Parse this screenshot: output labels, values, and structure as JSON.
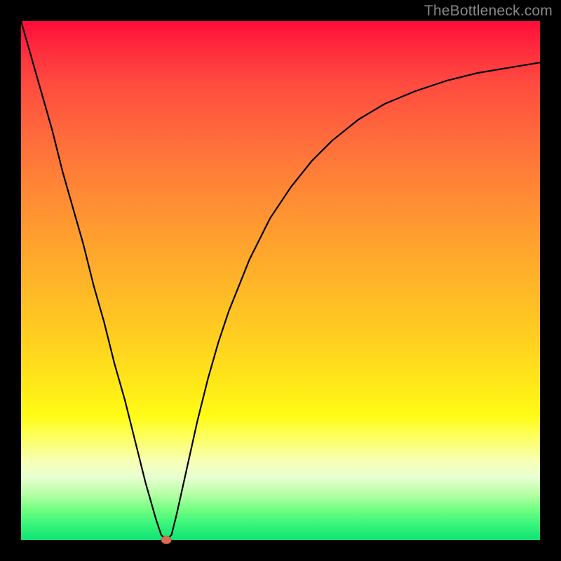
{
  "watermark": "TheBottleneck.com",
  "chart_data": {
    "type": "line",
    "title": "",
    "xlabel": "",
    "ylabel": "",
    "xlim": [
      0,
      100
    ],
    "ylim": [
      0,
      100
    ],
    "grid": false,
    "legend": false,
    "background_gradient": {
      "direction": "vertical",
      "stops": [
        {
          "pos": 0.0,
          "color": "#ff0d3a"
        },
        {
          "pos": 0.2,
          "color": "#ff6a3c"
        },
        {
          "pos": 0.45,
          "color": "#ffb927"
        },
        {
          "pos": 0.7,
          "color": "#ffe819"
        },
        {
          "pos": 0.88,
          "color": "#e7ffd0"
        },
        {
          "pos": 1.0,
          "color": "#10e274"
        }
      ]
    },
    "series": [
      {
        "name": "bottleneck-curve",
        "x": [
          0,
          2,
          4,
          6,
          8,
          10,
          12,
          14,
          16,
          18,
          20,
          22,
          24,
          26,
          27,
          28,
          29,
          30,
          32,
          34,
          36,
          38,
          40,
          44,
          48,
          52,
          56,
          60,
          65,
          70,
          76,
          82,
          88,
          94,
          100
        ],
        "y": [
          100,
          93,
          86,
          79,
          71,
          64,
          57,
          49,
          42,
          34,
          27,
          19,
          11,
          4,
          1,
          0,
          1,
          5,
          14,
          23,
          31,
          38,
          44,
          54,
          62,
          68,
          73,
          77,
          81,
          84,
          86.5,
          88.5,
          90,
          91,
          92
        ]
      }
    ],
    "marker": {
      "name": "optimal-point",
      "x": 28,
      "y": 0,
      "color": "#d96b53",
      "shape": "ellipse"
    }
  }
}
